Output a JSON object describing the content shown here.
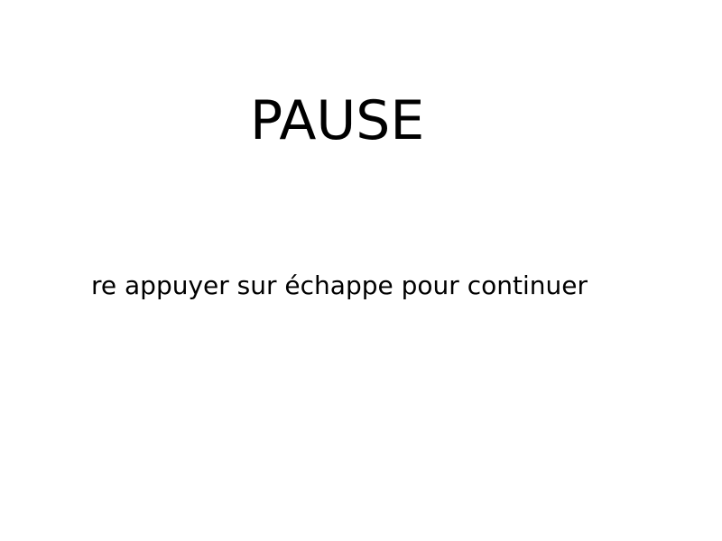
{
  "pause_screen": {
    "title": "PAUSE",
    "hint": "re appuyer sur échappe pour continuer"
  },
  "colors": {
    "background": "#ffffff",
    "text": "#000000"
  }
}
